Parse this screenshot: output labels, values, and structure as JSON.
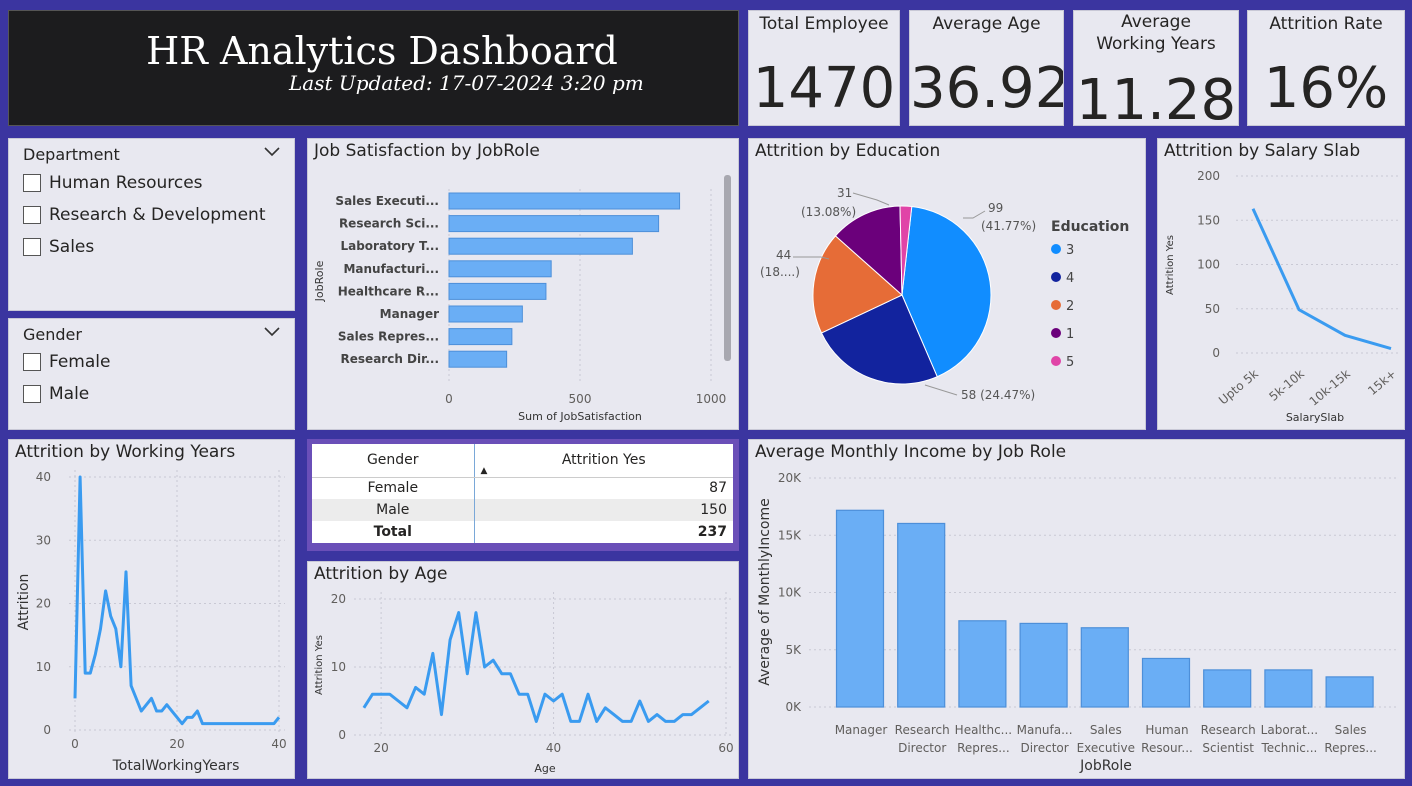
{
  "header": {
    "title": "HR Analytics Dashboard",
    "subtitle": "Last Updated: 17-07-2024 3:20 pm"
  },
  "kpis": [
    {
      "label": "Total Employee",
      "value": "1470"
    },
    {
      "label": "Average Age",
      "value": "36.92"
    },
    {
      "label": "Average Working Years",
      "value": "11.28"
    },
    {
      "label": "Attrition Rate",
      "value": "16%"
    }
  ],
  "slicers": {
    "department": {
      "title": "Department",
      "options": [
        "Human Resources",
        "Research & Development",
        "Sales"
      ]
    },
    "gender": {
      "title": "Gender",
      "options": [
        "Female",
        "Male"
      ]
    }
  },
  "gender_table": {
    "headers": [
      "Gender",
      "Attrition Yes"
    ],
    "rows": [
      {
        "gender": "Female",
        "value": "87"
      },
      {
        "gender": "Male",
        "value": "150"
      }
    ],
    "total": {
      "label": "Total",
      "value": "237"
    }
  },
  "colors": {
    "background": "#3b35a0",
    "bar": "#6aaef5",
    "line": "#3a9bf0"
  },
  "chart_data": [
    {
      "id": "job_satisfaction",
      "type": "bar",
      "orientation": "horizontal",
      "title": "Job Satisfaction by JobRole",
      "xlabel": "Sum of JobSatisfaction",
      "ylabel": "JobRole",
      "categories": [
        "Sales Executi...",
        "Research Sci...",
        "Laboratory T...",
        "Manufacturi...",
        "Healthcare R...",
        "Manager",
        "Sales Repres...",
        "Research Dir..."
      ],
      "values": [
        880,
        800,
        700,
        390,
        370,
        280,
        240,
        220
      ],
      "xlim": [
        0,
        1000
      ],
      "xticks": [
        "0",
        "500",
        "1000"
      ],
      "grid": true
    },
    {
      "id": "attrition_education",
      "type": "pie",
      "title": "Attrition by Education",
      "legend_title": "Education",
      "legend_position": "right",
      "slices": [
        {
          "name": "3",
          "value": 99,
          "label": "99",
          "pct": "(41.77%)",
          "color": "#118dff"
        },
        {
          "name": "4",
          "value": 58,
          "label": "58 (24.47%)",
          "pct": "",
          "color": "#12239e"
        },
        {
          "name": "2",
          "value": 44,
          "label": "44",
          "pct": "(18....)",
          "color": "#e66c37"
        },
        {
          "name": "1",
          "value": 31,
          "label": "31",
          "pct": "(13.08%)",
          "color": "#6b007b"
        },
        {
          "name": "5",
          "value": 5,
          "label": "",
          "pct": "",
          "color": "#e044a7"
        }
      ]
    },
    {
      "id": "attrition_salary",
      "type": "line",
      "title": "Attrition by Salary Slab",
      "xlabel": "SalarySlab",
      "ylabel": "Attrition Yes",
      "categories": [
        "Upto 5k",
        "5k-10k",
        "10k-15k",
        "15k+"
      ],
      "values": [
        163,
        49,
        20,
        5
      ],
      "ylim": [
        0,
        200
      ],
      "yticks": [
        "0",
        "50",
        "100",
        "150",
        "200"
      ]
    },
    {
      "id": "attrition_working_years",
      "type": "line",
      "title": "Attrition by Working Years",
      "xlabel": "TotalWorkingYears",
      "ylabel": "Attrition",
      "x": [
        0,
        1,
        2,
        3,
        4,
        5,
        6,
        7,
        8,
        9,
        10,
        11,
        12,
        13,
        14,
        15,
        16,
        17,
        18,
        19,
        20,
        21,
        22,
        23,
        24,
        25,
        26,
        27,
        28,
        29,
        30,
        31,
        32,
        33,
        34,
        35,
        36,
        37,
        38,
        39,
        40
      ],
      "y": [
        5,
        40,
        9,
        9,
        12,
        16,
        22,
        18,
        16,
        10,
        25,
        7,
        5,
        3,
        4,
        5,
        3,
        3,
        4,
        3,
        2,
        1,
        2,
        2,
        3,
        1,
        1,
        1,
        1,
        1,
        1,
        1,
        1,
        1,
        1,
        1,
        1,
        1,
        1,
        1,
        2
      ],
      "xlim": [
        0,
        40
      ],
      "ylim": [
        0,
        40
      ],
      "xticks": [
        "0",
        "20",
        "40"
      ],
      "yticks": [
        "0",
        "10",
        "20",
        "30",
        "40"
      ]
    },
    {
      "id": "attrition_age",
      "type": "line",
      "title": "Attrition by Age",
      "xlabel": "Age",
      "ylabel": "Attrition Yes",
      "x": [
        18,
        19,
        20,
        21,
        22,
        23,
        24,
        25,
        26,
        27,
        28,
        29,
        30,
        31,
        32,
        33,
        34,
        35,
        36,
        37,
        38,
        39,
        40,
        41,
        42,
        43,
        44,
        45,
        46,
        47,
        48,
        49,
        50,
        51,
        52,
        53,
        54,
        55,
        56,
        57,
        58
      ],
      "y": [
        4,
        6,
        6,
        6,
        5,
        4,
        7,
        6,
        12,
        3,
        14,
        18,
        9,
        18,
        10,
        11,
        9,
        9,
        6,
        6,
        2,
        6,
        5,
        6,
        2,
        2,
        6,
        2,
        4,
        3,
        2,
        2,
        5,
        2,
        3,
        2,
        2,
        3,
        3,
        4,
        5
      ],
      "xlim": [
        15,
        60
      ],
      "ylim": [
        0,
        20
      ],
      "xticks": [
        "20",
        "40",
        "60"
      ],
      "yticks": [
        "0",
        "10",
        "20"
      ]
    },
    {
      "id": "monthly_income",
      "type": "bar",
      "title": "Average Monthly Income by Job Role",
      "xlabel": "JobRole",
      "ylabel": "Average of MonthlyIncome",
      "categories": [
        [
          "Manager"
        ],
        [
          "Research",
          "Director"
        ],
        [
          "Healthc...",
          "Repres..."
        ],
        [
          "Manufa...",
          "Director"
        ],
        [
          "Sales",
          "Executive"
        ],
        [
          "Human",
          "Resour..."
        ],
        [
          "Research",
          "Scientist"
        ],
        [
          "Laborat...",
          "Technic..."
        ],
        [
          "Sales",
          "Repres..."
        ]
      ],
      "values": [
        17180,
        16030,
        7530,
        7300,
        6920,
        4240,
        3240,
        3240,
        2630
      ],
      "ylim": [
        0,
        20000
      ],
      "yticks": [
        "0K",
        "5K",
        "10K",
        "15K",
        "20K"
      ]
    }
  ]
}
